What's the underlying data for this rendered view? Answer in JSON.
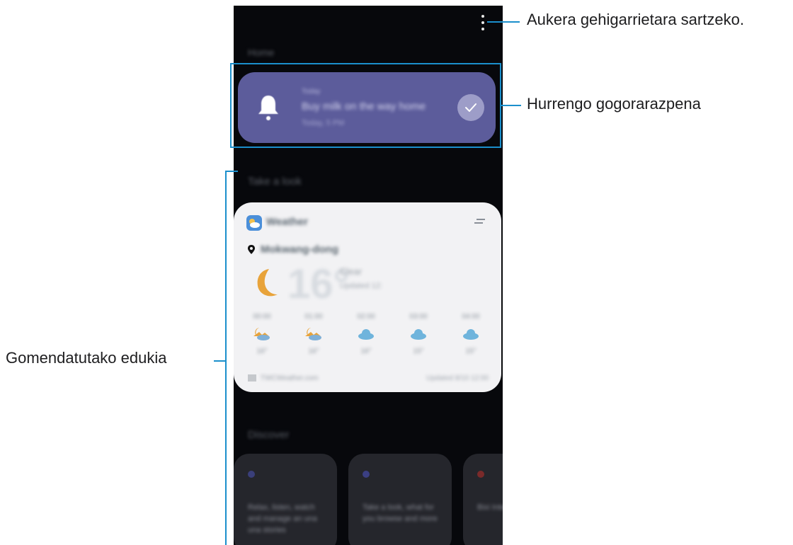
{
  "header": {
    "section_label": "Home",
    "more_options_icon": "more-vertical-icon"
  },
  "reminder": {
    "title": "Today",
    "text": "Buy milk on the way home",
    "time": "Today, 5 PM",
    "bell_icon": "bell-icon",
    "check_icon": "check-icon",
    "color": "#5c5c9b"
  },
  "recommended": {
    "section_label": "Take a look"
  },
  "weather": {
    "app_name": "Weather",
    "location": "Mokwang-dong",
    "temperature": "16°",
    "condition": "Clear",
    "feels_like": "Updated 12:",
    "forecast": [
      {
        "time": "00:00",
        "temp": "16°",
        "icon": "moon-cloud-icon"
      },
      {
        "time": "01:00",
        "temp": "16°",
        "icon": "moon-cloud-icon"
      },
      {
        "time": "02:00",
        "temp": "16°",
        "icon": "cloud-icon"
      },
      {
        "time": "03:00",
        "temp": "15°",
        "icon": "cloud-icon"
      },
      {
        "time": "04:00",
        "temp": "15°",
        "icon": "cloud-icon"
      }
    ],
    "source": "TWCWeather.com",
    "updated": "Updated 8/10 12:00"
  },
  "discover": {
    "section_label": "Discover",
    "cards": [
      {
        "text": "Relax, listen, watch and manage an una una stories",
        "dot_color": "#3a3f7a"
      },
      {
        "text": "Take a look, what for you browse and more",
        "dot_color": "#3b3f83"
      },
      {
        "text": "Bixi Integr your",
        "dot_color": "#7a2a2a"
      }
    ]
  },
  "callouts": {
    "more_options": "Aukera gehigarrietara sartzeko.",
    "next_reminder": "Hurrengo gogorarazpena",
    "recommended_content": "Gomendatutako edukia"
  },
  "colors": {
    "callout_line": "#1b8fcc",
    "screen_background": "#07080c"
  }
}
